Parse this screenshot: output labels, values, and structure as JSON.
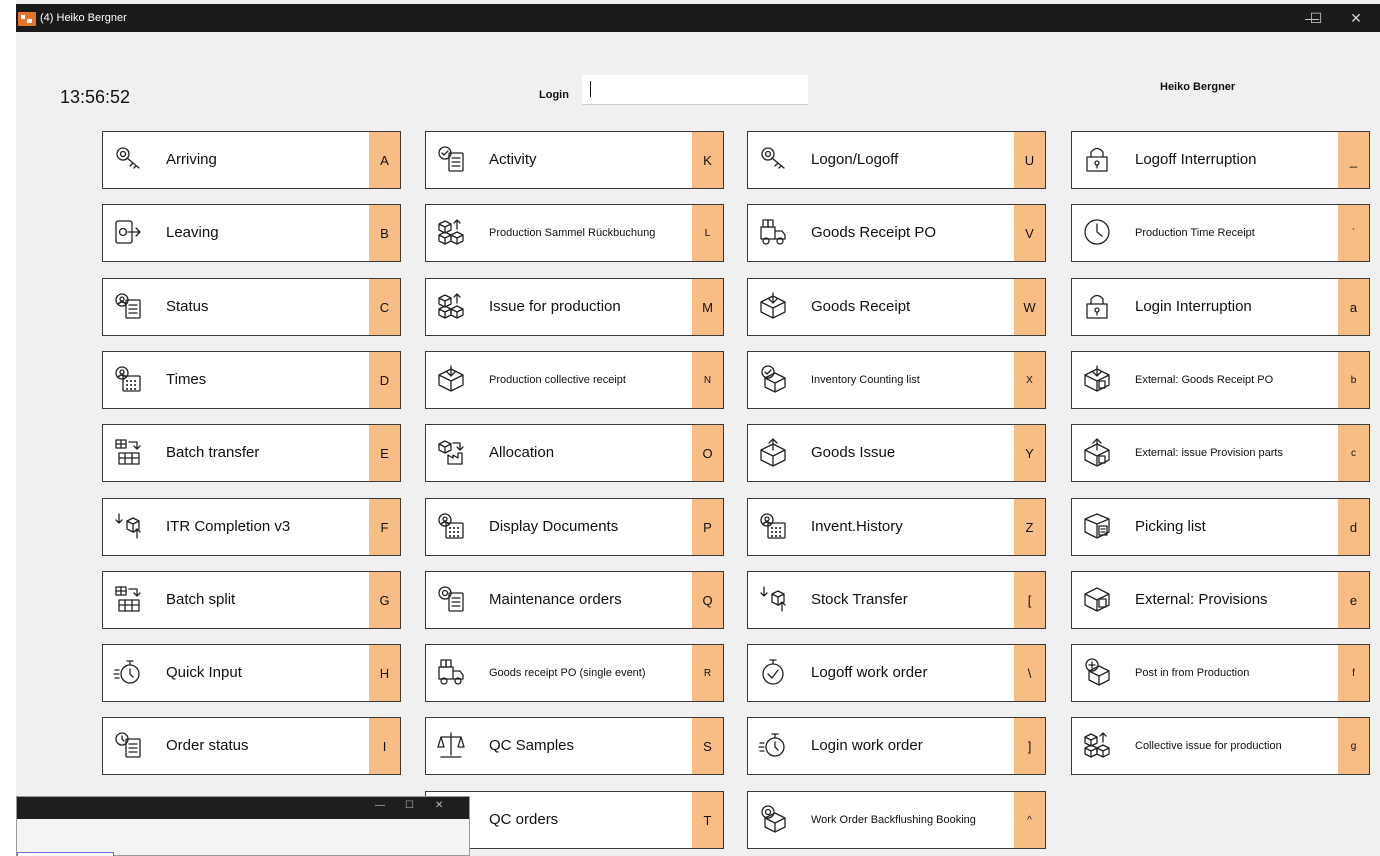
{
  "window": {
    "title": "(4) Heiko Bergner",
    "controls": {
      "minimize": "—",
      "maximize": "☐",
      "close": "✕"
    }
  },
  "header": {
    "clock": "13:56:52",
    "login_label": "Login",
    "login_value": "",
    "user_name": "Heiko Bergner"
  },
  "colors": {
    "key_bg": "#f8bd84",
    "titlebar": "#1a1a1a",
    "background": "#f0f0f0"
  },
  "columns": [
    [
      {
        "label": "Arriving",
        "key": "A",
        "icon": "key-icon"
      },
      {
        "label": "Leaving",
        "key": "B",
        "icon": "exit-icon"
      },
      {
        "label": "Status",
        "key": "C",
        "icon": "user-list-icon"
      },
      {
        "label": "Times",
        "key": "D",
        "icon": "user-calendar-icon"
      },
      {
        "label": "Batch transfer",
        "key": "E",
        "icon": "grid-arrow-icon"
      },
      {
        "label": "ITR Completion v3",
        "key": "F",
        "icon": "cube-arrows-icon"
      },
      {
        "label": "Batch split",
        "key": "G",
        "icon": "grid-arrow-icon"
      },
      {
        "label": "Quick Input",
        "key": "H",
        "icon": "stopwatch-icon"
      },
      {
        "label": "Order status",
        "key": "I",
        "icon": "clock-list-icon"
      }
    ],
    [
      {
        "label": "Activity",
        "key": "K",
        "icon": "check-list-icon"
      },
      {
        "label": "Production Sammel Rückbuchung",
        "key": "L",
        "icon": "cubes-arrow-icon",
        "small": true
      },
      {
        "label": "Issue for production",
        "key": "M",
        "icon": "cubes-arrow-icon"
      },
      {
        "label": "Production collective receipt",
        "key": "N",
        "icon": "box-in-icon",
        "small": true
      },
      {
        "label": "Allocation",
        "key": "O",
        "icon": "cube-factory-icon"
      },
      {
        "label": "Display Documents",
        "key": "P",
        "icon": "user-calendar-icon"
      },
      {
        "label": "Maintenance orders",
        "key": "Q",
        "icon": "gear-list-icon"
      },
      {
        "label": "Goods receipt PO  (single event)",
        "key": "R",
        "icon": "truck-icon",
        "small": true
      },
      {
        "label": "QC Samples",
        "key": "S",
        "icon": "scale-icon"
      },
      {
        "label": "QC orders",
        "key": "T",
        "icon": "scale-icon"
      }
    ],
    [
      {
        "label": "Logon/Logoff",
        "key": "U",
        "icon": "key-icon"
      },
      {
        "label": "Goods Receipt PO",
        "key": "V",
        "icon": "truck-icon"
      },
      {
        "label": "Goods Receipt",
        "key": "W",
        "icon": "box-in-icon"
      },
      {
        "label": "Inventory Counting list",
        "key": "X",
        "icon": "box-check-icon",
        "small": true
      },
      {
        "label": "Goods Issue",
        "key": "Y",
        "icon": "box-out-icon"
      },
      {
        "label": "Invent.History",
        "key": "Z",
        "icon": "user-calendar-icon"
      },
      {
        "label": "Stock Transfer",
        "key": "[",
        "icon": "cube-arrows-icon"
      },
      {
        "label": "Logoff work order",
        "key": "\\",
        "icon": "stopwatch-check-icon"
      },
      {
        "label": "Login work order",
        "key": "]",
        "icon": "stopwatch-icon"
      },
      {
        "label": "Work Order Backflushing Booking",
        "key": "^",
        "icon": "box-gear-icon",
        "small": true
      }
    ],
    [
      {
        "label": "Logoff Interruption",
        "key": "_",
        "icon": "lock-icon"
      },
      {
        "label": "Production Time Receipt",
        "key": "`",
        "icon": "clock-icon",
        "small": true
      },
      {
        "label": "Login Interruption",
        "key": "a",
        "icon": "lock-icon"
      },
      {
        "label": "External: Goods Receipt PO",
        "key": "b",
        "icon": "box-in-doc-icon",
        "small": true
      },
      {
        "label": "External: issue Provision parts",
        "key": "c",
        "icon": "box-out-doc-icon",
        "small": true
      },
      {
        "label": "Picking list",
        "key": "d",
        "icon": "box-list-icon"
      },
      {
        "label": "External: Provisions",
        "key": "e",
        "icon": "box-doc-icon"
      },
      {
        "label": "Post in from Production",
        "key": "f",
        "icon": "box-plus-icon",
        "small": true
      },
      {
        "label": "Collective issue for production",
        "key": "g",
        "icon": "cubes-arrow-icon",
        "small": true
      }
    ]
  ]
}
